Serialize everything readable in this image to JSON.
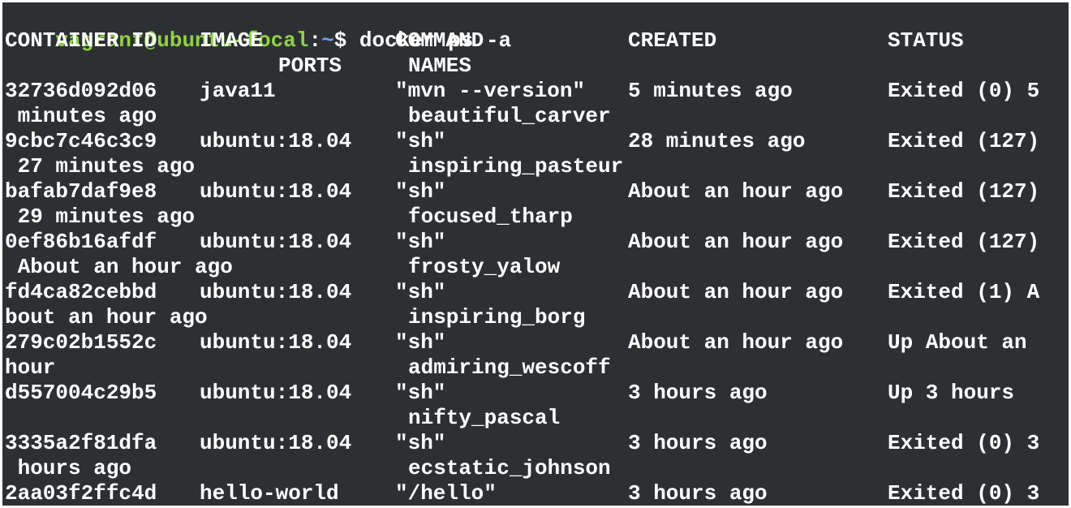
{
  "terminal": {
    "prompt_user": "vagrant@ubuntu-focal",
    "prompt_sep": ":",
    "prompt_path": "~",
    "prompt_symbol": "$",
    "command": "docker ps -a"
  },
  "table": {
    "headers": {
      "container_id": "CONTAINER ID",
      "image": "IMAGE",
      "command": "COMMAND",
      "created": "CREATED",
      "status": "STATUS",
      "ports": "PORTS",
      "names": "NAMES"
    },
    "rows": [
      {
        "container_id": "32736d092d06",
        "image": "java11",
        "command": "\"mvn --version\"",
        "created": "5 minutes ago",
        "status_line1": "Exited (0) 5",
        "status_line2": " minutes ago",
        "name": "beautiful_carver"
      },
      {
        "container_id": "9cbc7c46c3c9",
        "image": "ubuntu:18.04",
        "command": "\"sh\"",
        "created": "28 minutes ago",
        "status_line1": "Exited (127)",
        "status_line2": " 27 minutes ago",
        "name": "inspiring_pasteur"
      },
      {
        "container_id": "bafab7daf9e8",
        "image": "ubuntu:18.04",
        "command": "\"sh\"",
        "created": "About an hour ago",
        "status_line1": "Exited (127)",
        "status_line2": " 29 minutes ago",
        "name": "focused_tharp"
      },
      {
        "container_id": "0ef86b16afdf",
        "image": "ubuntu:18.04",
        "command": "\"sh\"",
        "created": "About an hour ago",
        "status_line1": "Exited (127)",
        "status_line2": " About an hour ago",
        "name": "frosty_yalow"
      },
      {
        "container_id": "fd4ca82cebbd",
        "image": "ubuntu:18.04",
        "command": "\"sh\"",
        "created": "About an hour ago",
        "status_line1": "Exited (1) A",
        "status_line2": "bout an hour ago",
        "name": "inspiring_borg"
      },
      {
        "container_id": "279c02b1552c",
        "image": "ubuntu:18.04",
        "command": "\"sh\"",
        "created": "About an hour ago",
        "status_line1": "Up About an",
        "status_line2": "hour",
        "name": "admiring_wescoff"
      },
      {
        "container_id": "d557004c29b5",
        "image": "ubuntu:18.04",
        "command": "\"sh\"",
        "created": "3 hours ago",
        "status_line1": "Up 3 hours",
        "status_line2": "",
        "name": "nifty_pascal"
      },
      {
        "container_id": "3335a2f81dfa",
        "image": "ubuntu:18.04",
        "command": "\"sh\"",
        "created": "3 hours ago",
        "status_line1": "Exited (0) 3",
        "status_line2": " hours ago",
        "name": "ecstatic_johnson"
      },
      {
        "container_id": "2aa03f2ffc4d",
        "image": "hello-world",
        "command": "\"/hello\"",
        "created": "3 hours ago",
        "status_line1": "Exited (0) 3",
        "status_line2": "",
        "name": ""
      }
    ]
  },
  "colors": {
    "background": "#2d3033",
    "text": "#ffffff",
    "prompt_user": "#8fd14a",
    "prompt_path": "#6fa3e8"
  }
}
